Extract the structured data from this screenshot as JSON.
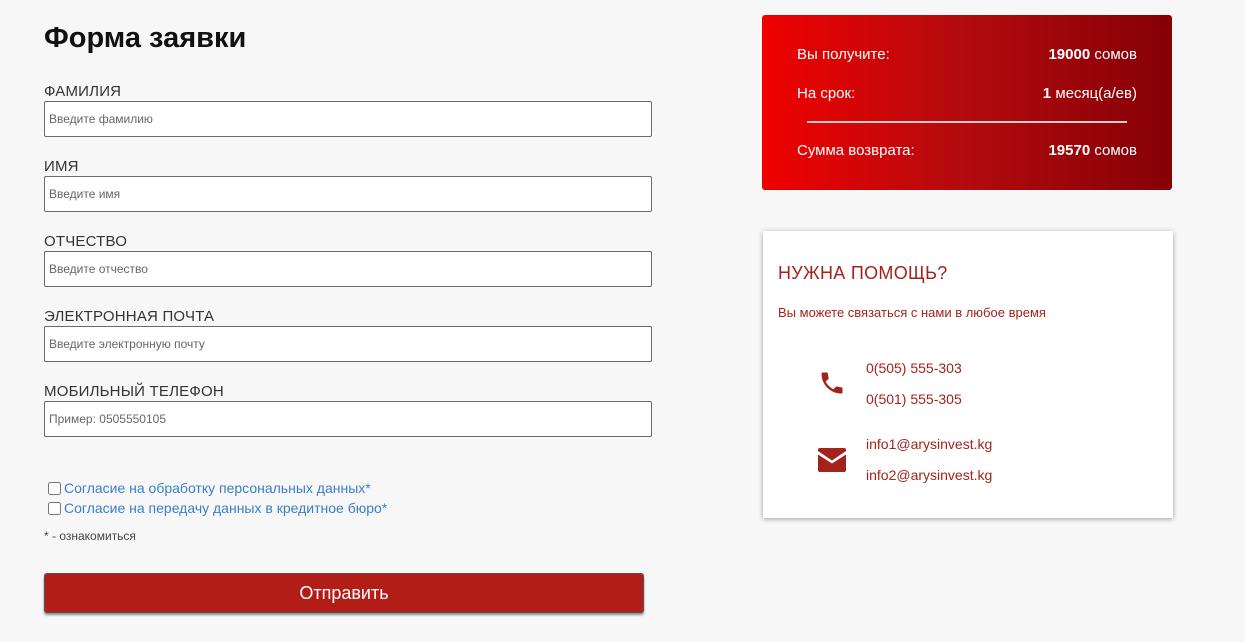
{
  "form": {
    "title": "Форма заявки",
    "fields": [
      {
        "label": "ФАМИЛИЯ",
        "placeholder": "Введите фамилию",
        "value": ""
      },
      {
        "label": "ИМЯ",
        "placeholder": "Введите имя",
        "value": ""
      },
      {
        "label": "ОТЧЕСТВО",
        "placeholder": "Введите отчество",
        "value": ""
      },
      {
        "label": "ЭЛЕКТРОННАЯ ПОЧТА",
        "placeholder": "Введите электронную почту",
        "value": ""
      },
      {
        "label": "МОБИЛЬНЫЙ ТЕЛЕФОН",
        "placeholder": "Пример: 0505550105",
        "value": ""
      }
    ],
    "consents": [
      {
        "label": "Согласие на обработку персональных данных*",
        "checked": false
      },
      {
        "label": "Согласие на передачу данных в кредитное бюро*",
        "checked": false
      }
    ],
    "note": "* - ознакомиться",
    "submit_label": "Отправить"
  },
  "summary": {
    "receive_label": "Вы получите:",
    "receive_amount": "19000",
    "receive_unit": "сомов",
    "term_label": "На срок:",
    "term_value": "1",
    "term_unit": "месяц(а/ев)",
    "return_label": "Сумма возврата:",
    "return_amount": "19570",
    "return_unit": "сомов"
  },
  "help": {
    "title": "НУЖНА ПОМОЩЬ?",
    "subtitle": "Вы можете связаться с нами в любое время",
    "phones": [
      "0(505) 555-303",
      "0(501) 555-305"
    ],
    "emails": [
      "info1@arysinvest.kg",
      "info2@arysinvest.kg"
    ]
  },
  "colors": {
    "accent": "#b21e17",
    "help_text": "#a3231c",
    "link": "#3a7fc8",
    "gradient_start": "#f00000",
    "gradient_end": "#850006"
  },
  "icons": {
    "phone": "phone-icon",
    "email": "envelope-icon"
  }
}
